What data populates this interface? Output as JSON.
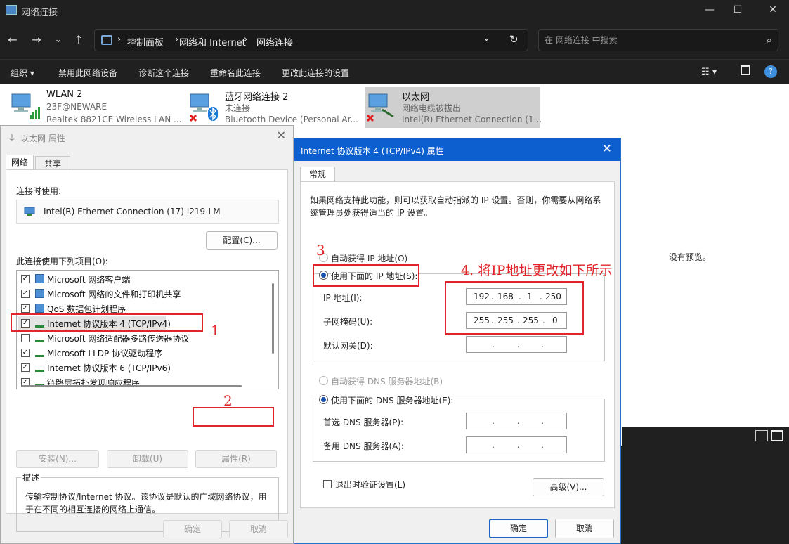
{
  "window": {
    "title": "网络连接",
    "minimize": "—",
    "maximize": "☐",
    "close": "✕"
  },
  "nav": {
    "back": "←",
    "forward": "→",
    "dropdown": "⌄",
    "up": "↑",
    "refresh": "↻",
    "history": "⌄"
  },
  "breadcrumb": [
    "控制面板",
    "网络和 Internet",
    "网络连接"
  ],
  "search": {
    "placeholder": "在 网络连接 中搜索"
  },
  "commands": {
    "organize": "组织 ▾",
    "disable": "禁用此网络设备",
    "diagnose": "诊断这个连接",
    "rename": "重命名此连接",
    "change": "更改此连接的设置"
  },
  "adapters": [
    {
      "name": "WLAN 2",
      "status": "23F@NEWARE",
      "device": "Realtek 8821CE Wireless LAN ..."
    },
    {
      "name": "蓝牙网络连接 2",
      "status": "未连接",
      "device": "Bluetooth Device (Personal Ar..."
    },
    {
      "name": "以太网",
      "status": "网络电缆被拔出",
      "device": "Intel(R) Ethernet Connection (1..."
    }
  ],
  "preview": {
    "empty": "没有预览。"
  },
  "eth_dialog": {
    "title": "以太网 属性",
    "tabs": [
      "网络",
      "共享"
    ],
    "connect_using_label": "连接时使用:",
    "adapter_name": "Intel(R) Ethernet Connection (17) I219-LM",
    "configure": "配置(C)...",
    "items_label": "此连接使用下列项目(O):",
    "items": [
      {
        "label": "Microsoft 网络客户端",
        "checked": true
      },
      {
        "label": "Microsoft 网络的文件和打印机共享",
        "checked": true
      },
      {
        "label": "QoS 数据包计划程序",
        "checked": true
      },
      {
        "label": "Internet 协议版本 4 (TCP/IPv4)",
        "checked": true
      },
      {
        "label": "Microsoft 网络适配器多路传送器协议",
        "checked": false
      },
      {
        "label": "Microsoft LLDP 协议驱动程序",
        "checked": true
      },
      {
        "label": "Internet 协议版本 6 (TCP/IPv6)",
        "checked": true
      },
      {
        "label": "链路层拓扑发现响应程序",
        "checked": true
      }
    ],
    "install": "安装(N)...",
    "uninstall": "卸载(U)",
    "properties": "属性(R)",
    "description_label": "描述",
    "description": "传输控制协议/Internet 协议。该协议是默认的广域网络协议，用于在不同的相互连接的网络上通信。",
    "ok": "确定",
    "cancel": "取消"
  },
  "ipv4_dialog": {
    "title": "Internet 协议版本 4 (TCP/IPv4) 属性",
    "tab": "常规",
    "intro": "如果网络支持此功能，则可以获取自动指派的 IP 设置。否则，你需要从网络系统管理员处获得适当的 IP 设置。",
    "auto_ip": "自动获得 IP 地址(O)",
    "manual_ip": "使用下面的 IP 地址(S):",
    "ip_label": "IP 地址(I):",
    "ip": [
      "192",
      "168",
      "1",
      "250"
    ],
    "mask_label": "子网掩码(U):",
    "mask": [
      "255",
      "255",
      "255",
      "0"
    ],
    "gateway_label": "默认网关(D):",
    "auto_dns": "自动获得 DNS 服务器地址(B)",
    "manual_dns": "使用下面的 DNS 服务器地址(E):",
    "dns1_label": "首选 DNS 服务器(P):",
    "dns2_label": "备用 DNS 服务器(A):",
    "validate": "退出时验证设置(L)",
    "advanced": "高级(V)...",
    "ok": "确定",
    "cancel": "取消"
  },
  "annotations": {
    "step1": "1",
    "step2": "2",
    "step3": "3",
    "step4": "4. 将IP地址更改如下所示"
  },
  "colors": {
    "annotation": "#e0262b",
    "accent": "#0d5fd0"
  }
}
